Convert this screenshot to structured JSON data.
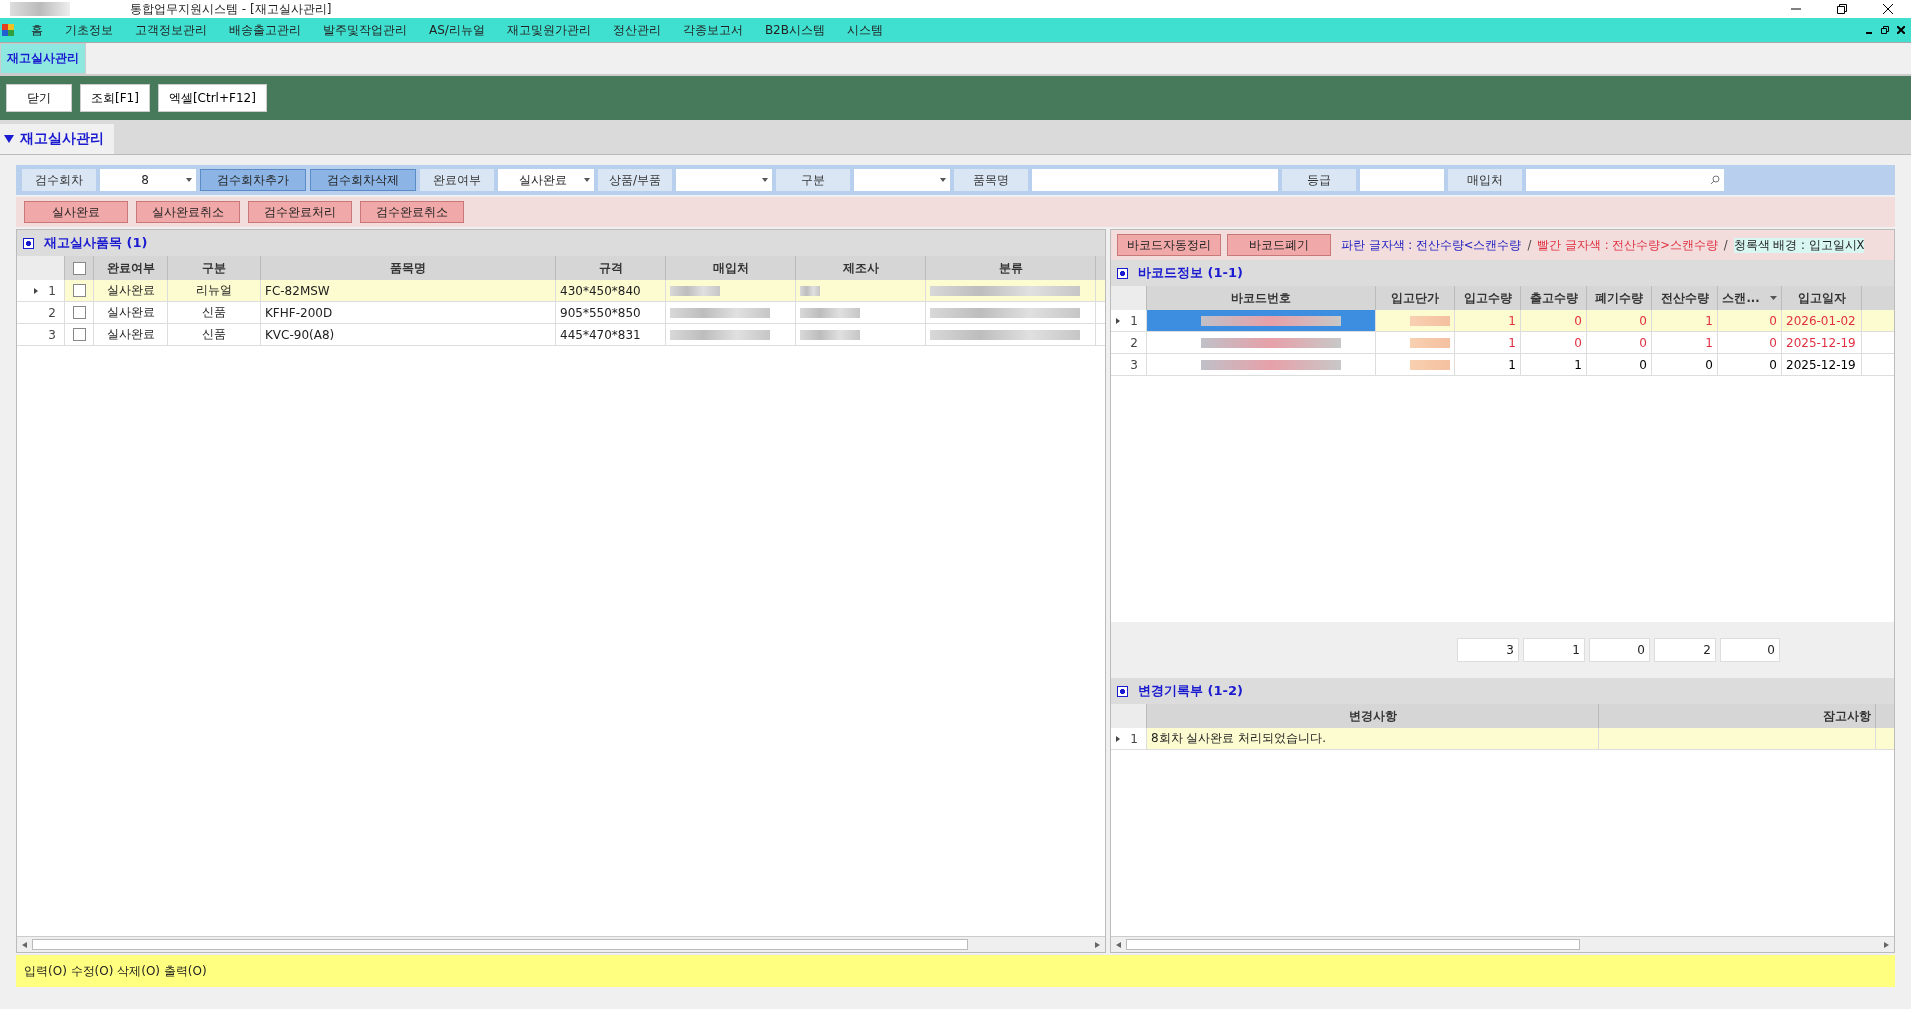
{
  "window": {
    "title": "통합업무지원시스템 - [재고실사관리]"
  },
  "menu": [
    "홈",
    "기초정보",
    "고객정보관리",
    "배송출고관리",
    "발주및작업관리",
    "AS/리뉴얼",
    "재고및원가관리",
    "정산관리",
    "각종보고서",
    "B2B시스템",
    "시스템"
  ],
  "tabs": [
    {
      "label": "재고실사관리",
      "selected": true
    }
  ],
  "toolbar": [
    "닫기",
    "조회[F1]",
    "엑셀[Ctrl+F12]"
  ],
  "section": {
    "title": "재고실사관리",
    "expanded": true
  },
  "filters": [
    {
      "kind": "combo",
      "label": "검수회차",
      "value": "8"
    },
    {
      "kind": "button",
      "label": "검수회차추가"
    },
    {
      "kind": "button",
      "label": "검수회차삭제"
    },
    {
      "kind": "combo",
      "label": "완료여부",
      "value": "실사완료"
    },
    {
      "kind": "combo",
      "label": "상품/부품"
    },
    {
      "kind": "combo",
      "label": "구분"
    },
    {
      "kind": "text",
      "label": "품목명"
    },
    {
      "kind": "text",
      "label": "등급"
    },
    {
      "kind": "search",
      "label": "매입처"
    }
  ],
  "left_buttons": [
    "실사완료",
    "실사완료취소",
    "검수완료처리",
    "검수완료취소"
  ],
  "right_buttons": [
    "바코드자동정리",
    "바코드폐기"
  ],
  "legend": [
    {
      "kind": "text",
      "text": "파란 글자색 : 전산수량<스캔수량",
      "color": "#2020c0"
    },
    {
      "kind": "separator",
      "text": "/"
    },
    {
      "kind": "text",
      "text": "빨간 글자색 : 전산수량>스캔수량",
      "color": "#e03040"
    },
    {
      "kind": "separator",
      "text": "/"
    },
    {
      "kind": "background",
      "text": "청록색 배경 : 입고일시X",
      "color": "#d8f7f2"
    }
  ],
  "items_panel": {
    "title": "재고실사품목 (1)",
    "all_checked": false,
    "columns": [
      "완료여부",
      "구분",
      "품목명",
      "규격",
      "매입처",
      "제조사",
      "분류"
    ],
    "rows": [
      {
        "num": "1",
        "selected": true,
        "checked": false,
        "status": "실사완료",
        "type": "리뉴얼",
        "name": "FC-82MSW",
        "size": "430*450*840",
        "blurred": true
      },
      {
        "num": "2",
        "selected": false,
        "checked": false,
        "status": "실사완료",
        "type": "신품",
        "name": "KFHF-200D",
        "size": "905*550*850",
        "blurred": true
      },
      {
        "num": "3",
        "selected": false,
        "checked": false,
        "status": "실사완료",
        "type": "신품",
        "name": "KVC-90(A8)",
        "size": "445*470*831",
        "blurred": true
      }
    ]
  },
  "barcode_panel": {
    "title": "바코드정보 (1-1)",
    "columns": [
      "바코드번호",
      "입고단가",
      "입고수량",
      "출고수량",
      "폐기수량",
      "전산수량",
      "스캔...",
      "입고일자"
    ],
    "rows": [
      {
        "num": "1",
        "selected": true,
        "color": "#e03040",
        "in_qty": "1",
        "out_qty": "0",
        "waste_qty": "0",
        "system_qty": "1",
        "scan_qty": "0",
        "date": "2026-01-02"
      },
      {
        "num": "2",
        "selected": false,
        "color": "#e03040",
        "in_qty": "1",
        "out_qty": "0",
        "waste_qty": "0",
        "system_qty": "1",
        "scan_qty": "0",
        "date": "2025-12-19"
      },
      {
        "num": "3",
        "selected": false,
        "color": "#000000",
        "in_qty": "1",
        "out_qty": "1",
        "waste_qty": "0",
        "system_qty": "0",
        "scan_qty": "0",
        "date": "2025-12-19"
      }
    ],
    "totals": [
      "3",
      "1",
      "0",
      "2",
      "0"
    ]
  },
  "changes_panel": {
    "title": "변경기록부 (1-2)",
    "columns": [
      "변경사항",
      "잠고사항"
    ],
    "rows": [
      {
        "num": "1",
        "selected": true,
        "change": "8회차 실사완료 처리되었습니다."
      }
    ]
  },
  "status_bar": "입력(O) 수정(O) 삭제(O) 출력(O)"
}
